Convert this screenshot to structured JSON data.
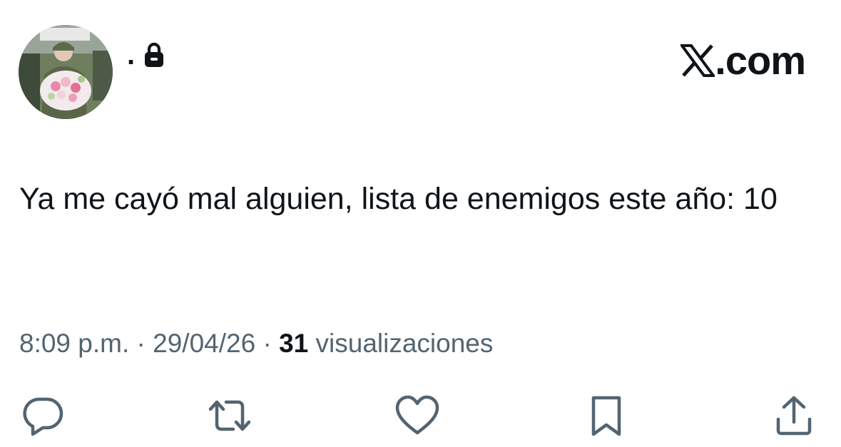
{
  "tweet": {
    "display_name": ".",
    "brand": ".com",
    "text": "Ya me cayó mal alguien, lista de enemigos este año: 10",
    "time": "8:09 p.m.",
    "separator": "·",
    "date": "29/04/26",
    "views_count": "31",
    "views_label": "visualizaciones"
  },
  "icons": {
    "avatar": "avatar-photo",
    "lock": "lock-icon",
    "brand_logo": "x-logo-icon",
    "reply": "reply-icon",
    "retweet": "retweet-icon",
    "like": "heart-icon",
    "bookmark": "bookmark-icon",
    "share": "share-icon"
  },
  "colors": {
    "text_primary": "#0f1419",
    "text_secondary": "#536471",
    "action_icon": "#536471",
    "background": "#ffffff"
  }
}
